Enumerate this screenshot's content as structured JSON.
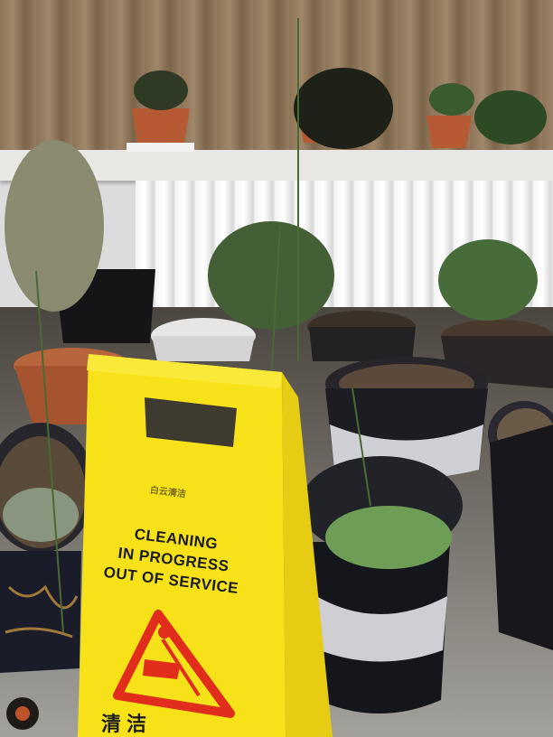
{
  "scene": {
    "description_colors": {
      "sign_yellow": "#f7e21a",
      "warning_red": "#e12d1b",
      "pot_dark": "#1f1f24",
      "curtain": "#8d7458"
    }
  },
  "sign": {
    "brand": "白云清洁",
    "line1": "CLEANING",
    "line2": "IN PROGRESS",
    "line3": "OUT OF SERVICE",
    "chinese": "清 洁"
  }
}
